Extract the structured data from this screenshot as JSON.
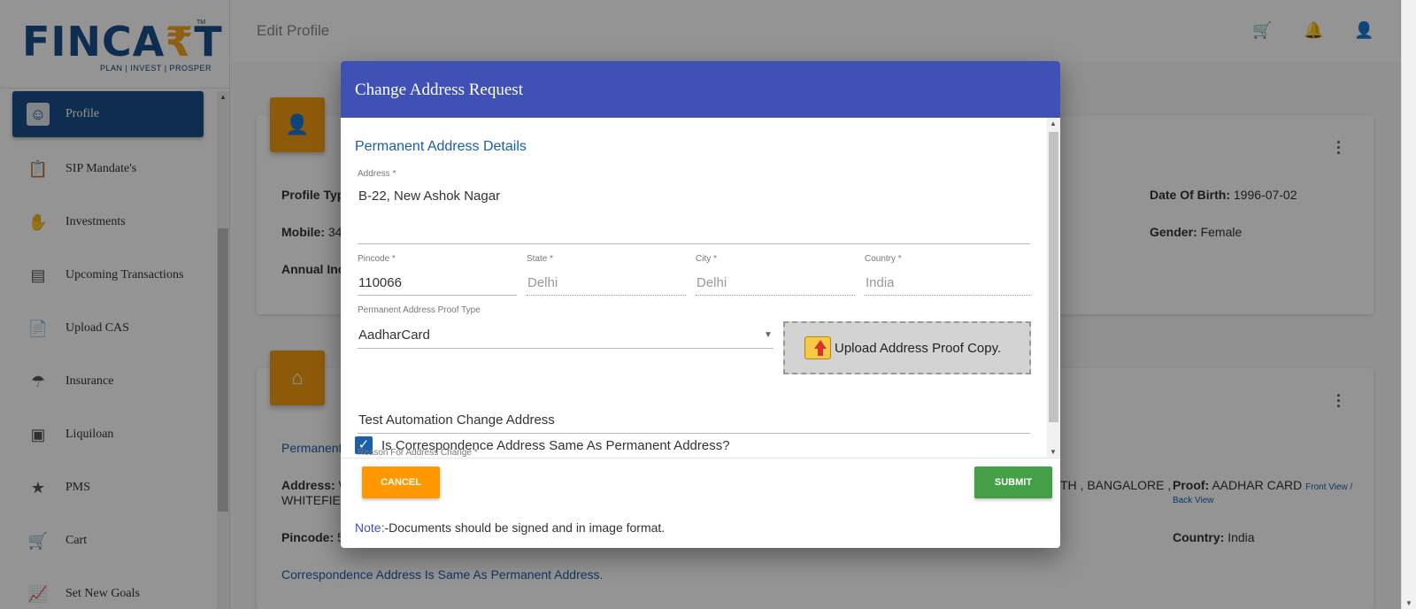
{
  "sidebar": {
    "logo_text_pre": "FINCA",
    "logo_text_rupee": "₹",
    "logo_text_post": "T",
    "logo_tm": "TM",
    "logo_tagline": "PLAN | INVEST | PROSPER",
    "items": [
      {
        "label": "Profile",
        "icon": "profile-icon"
      },
      {
        "label": "SIP Mandate's",
        "icon": "mandate-icon"
      },
      {
        "label": "Investments",
        "icon": "investments-icon"
      },
      {
        "label": "Upcoming Transactions",
        "icon": "transactions-icon"
      },
      {
        "label": "Upload CAS",
        "icon": "upload-cas-icon"
      },
      {
        "label": "Insurance",
        "icon": "insurance-icon"
      },
      {
        "label": "Liquiloan",
        "icon": "liquiloan-icon"
      },
      {
        "label": "PMS",
        "icon": "pms-icon"
      },
      {
        "label": "Cart",
        "icon": "cart-icon"
      },
      {
        "label": "Set New Goals",
        "icon": "goals-icon"
      }
    ]
  },
  "header": {
    "title": "Edit Profile"
  },
  "background": {
    "profile_type_label": "Profile Typ",
    "mobile_label": "Mobile:",
    "mobile_value": "34",
    "annual_income_label": "Annual Inc",
    "dob_label": "Date Of Birth:",
    "dob_value": "1996-07-02",
    "gender_label": "Gender:",
    "gender_value": "Female",
    "permanent_label": "Permanent",
    "address_label": "Address:",
    "address_value": "W",
    "address_cont": "WHITEFIEL",
    "address_tail": "TH , BANGALORE ,",
    "proof_label": "Proof:",
    "proof_value": "AADHAR CARD",
    "front_view": "Front View /",
    "back_view": "Back View",
    "pincode_label": "Pincode:",
    "pincode_value": "5",
    "country_label": "Country:",
    "country_value": "India",
    "correspondence_note": "Correspondence Address Is Same As Permanent Address."
  },
  "modal": {
    "title": "Change Address Request",
    "section_title": "Permanent Address Details",
    "address_label": "Address *",
    "address_value": "B-22, New Ashok Nagar",
    "pincode_label": "Pincode *",
    "pincode_value": "110066",
    "state_label": "State *",
    "state_value": "Delhi",
    "city_label": "City *",
    "city_value": "Delhi",
    "country_label": "Country *",
    "country_value": "India",
    "proof_type_label": "Permanent Address Proof Type",
    "proof_type_value": "AadharCard",
    "upload_label": "Upload Address Proof Copy.",
    "checkbox_label": "Is Correspondence Address Same As Permanent Address?",
    "checkbox_checked": true,
    "reason_label": "Reason For Address Change *",
    "reason_value": "Test Automation Change Address",
    "cancel_label": "CANCEL",
    "submit_label": "SUBMIT",
    "note_key": "Note:",
    "note_text": "-Documents should be signed and in image format."
  },
  "colors": {
    "modal_header": "#3f51b5",
    "brand_blue": "#1b4f8a",
    "accent_orange": "#ff9800",
    "submit_green": "#43a047"
  }
}
